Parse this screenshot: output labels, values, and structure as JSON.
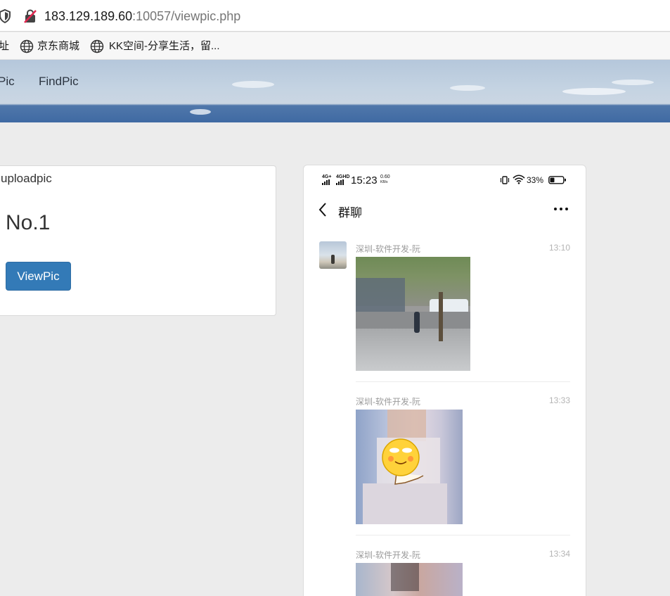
{
  "browser": {
    "url_host": "183.129.189.60",
    "url_rest": ":10057/viewpic.php",
    "bookmarks": [
      {
        "label": "址"
      },
      {
        "label": "京东商城"
      },
      {
        "label": "KK空间-分享生活，留..."
      }
    ]
  },
  "header": {
    "nav_partial": "Pic",
    "nav_findpic": "FindPic"
  },
  "panel": {
    "title": "uploadpic",
    "number": "No.1",
    "button": "ViewPic"
  },
  "phone": {
    "status": {
      "net1": "4G+",
      "net2": "4GHD",
      "time": "15:23",
      "speed_value": "0.60",
      "speed_unit": "KB/s",
      "battery": "33%"
    },
    "chat_title": "群聊",
    "messages": [
      {
        "sender": "深圳-软件开发-阮",
        "time": "13:10"
      },
      {
        "sender": "深圳-软件开发-阮",
        "time": "13:33"
      },
      {
        "sender": "深圳-软件开发-阮",
        "time": "13:34"
      }
    ]
  }
}
